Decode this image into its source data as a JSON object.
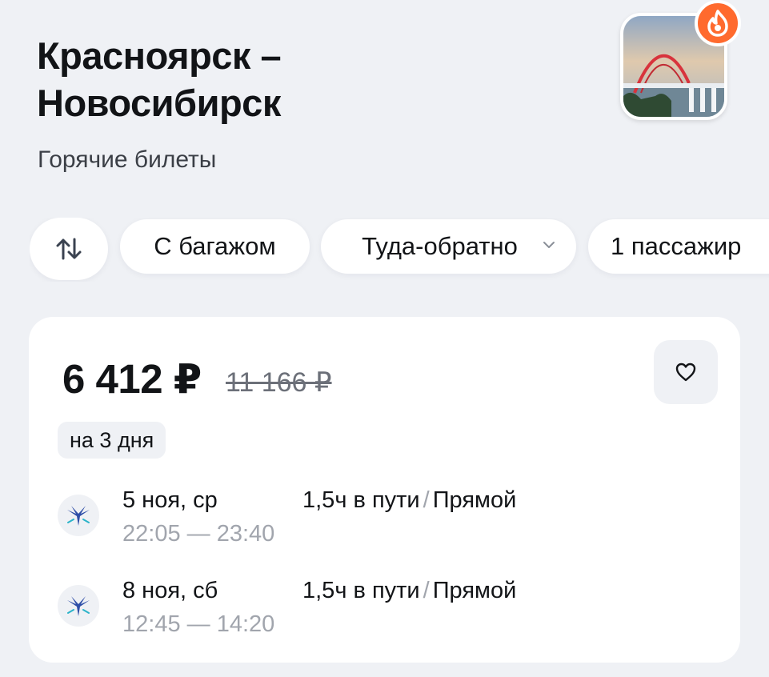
{
  "header": {
    "title_line1": "Красноярск –",
    "title_line2": "Новосибирск",
    "subtitle": "Горячие билеты",
    "badge_icon": "fire-icon",
    "photo_icon": "bridge-photo"
  },
  "filters": {
    "swap_icon": "swap-arrows-icon",
    "baggage": "С багажом",
    "trip_type": "Туда-обратно",
    "passengers": "1 пассажир"
  },
  "offer": {
    "price": "6 412 ₽",
    "old_price": "11 166 ₽",
    "duration_badge": "на 3 дня",
    "favorite_icon": "heart-icon",
    "segments": [
      {
        "date": "5 ноя, ср",
        "depart": "22:05",
        "arrive": "23:40",
        "duration": "1,5ч в пути",
        "sep": "/",
        "type": "Прямой"
      },
      {
        "date": "8 ноя, сб",
        "depart": "12:45",
        "arrive": "14:20",
        "duration": "1,5ч в пути",
        "sep": "/",
        "type": "Прямой"
      }
    ]
  },
  "colors": {
    "background": "#eff1f5",
    "card": "#ffffff",
    "hot_accent": "#ff6a2e",
    "muted_text": "#a1a5ad",
    "airline_logo": "#2f4fa8"
  }
}
